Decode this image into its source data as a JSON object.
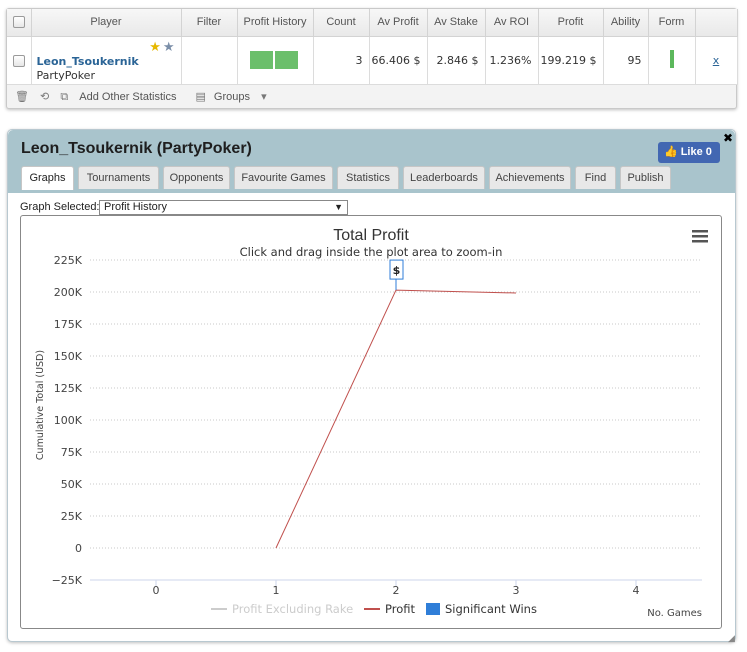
{
  "stats": {
    "headers": [
      "",
      "Player",
      "Filter",
      "Profit History",
      "Count",
      "Av Profit",
      "Av Stake",
      "Av ROI",
      "Profit",
      "Ability",
      "Form",
      ""
    ],
    "row": {
      "player_name": "Leon_Tsoukernik",
      "player_site": "PartyPoker",
      "count": "3",
      "av_profit": "66.406 $",
      "av_stake": "2.846 $",
      "av_roi": "1.236%",
      "profit": "199.219 $",
      "ability": "95",
      "remove": "x"
    },
    "toolbar": {
      "add_stats": "Add Other Statistics",
      "groups": "Groups"
    },
    "colors": {
      "history_bar": "#6bbf6b",
      "form_bar": "#5cb85c",
      "link": "#2a6496"
    }
  },
  "panel": {
    "title": "Leon_Tsoukernik (PartyPoker)",
    "like_label": "Like 0",
    "close": "✖",
    "tabs": [
      "Graphs",
      "Tournaments",
      "Opponents",
      "Favourite Games",
      "Statistics",
      "Leaderboards",
      "Achievements",
      "Find",
      "Publish"
    ],
    "active_tab": "Graphs",
    "graph_select_label": "Graph Selected:",
    "graph_select_value": "Profit History",
    "colors": {
      "header": "#a9c4cc",
      "like_button": "#4267b2"
    }
  },
  "chart_data": {
    "type": "line",
    "title": "Total Profit",
    "subtitle": "Click and drag inside the plot area to zoom-in",
    "ylabel": "Cumulative Total (USD)",
    "xlabel": "No. Games",
    "ylim": [
      -25000,
      225000
    ],
    "xlim": [
      -0.55,
      4.55
    ],
    "y_ticks": [
      225000,
      200000,
      175000,
      150000,
      125000,
      100000,
      75000,
      50000,
      25000,
      0,
      -25000
    ],
    "y_tick_labels": [
      "225K",
      "200K",
      "175K",
      "150K",
      "125K",
      "100K",
      "75K",
      "50K",
      "25K",
      "0",
      "−25K"
    ],
    "x_ticks": [
      0,
      1,
      2,
      3,
      4
    ],
    "x_tick_labels": [
      "0",
      "1",
      "2",
      "3",
      "4"
    ],
    "grid": true,
    "legend_placement": "bottom",
    "series": [
      {
        "name": "Profit Excluding Rake",
        "x": [],
        "y": [],
        "color": "#cccccc",
        "visible": false
      },
      {
        "name": "Profit",
        "x": [
          1,
          2,
          3
        ],
        "y": [
          0,
          201500,
          199219
        ],
        "color": "#c0504d"
      },
      {
        "name": "Significant Wins",
        "x": [
          2
        ],
        "y": [
          201500
        ],
        "color": "#2f7ed8",
        "marker_label": "$"
      }
    ]
  }
}
